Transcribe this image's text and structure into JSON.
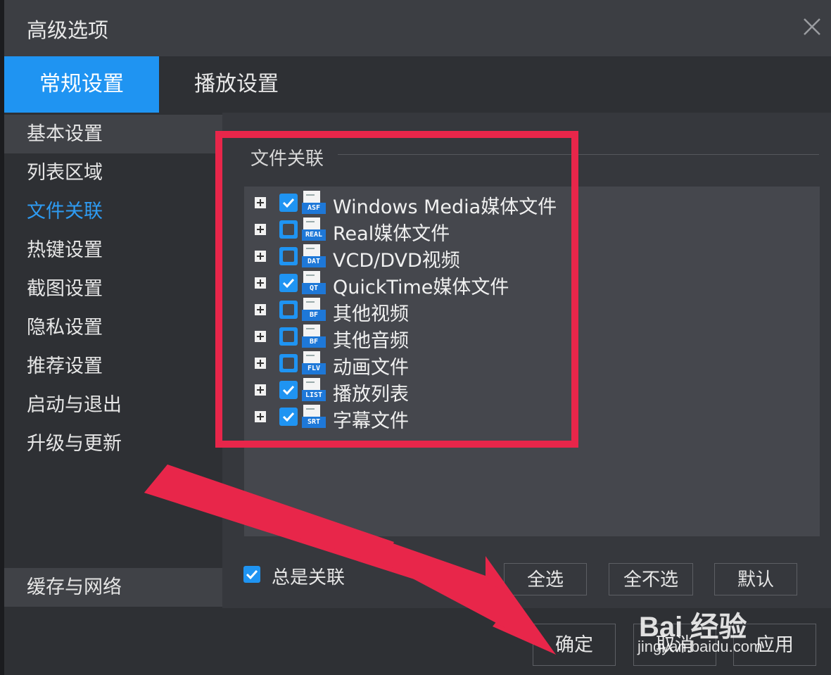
{
  "window": {
    "title": "高级选项"
  },
  "tabs": [
    {
      "label": "常规设置",
      "active": true
    },
    {
      "label": "播放设置",
      "active": false
    }
  ],
  "sidebar": {
    "items": [
      {
        "label": "基本设置"
      },
      {
        "label": "列表区域"
      },
      {
        "label": "文件关联"
      },
      {
        "label": "热键设置"
      },
      {
        "label": "截图设置"
      },
      {
        "label": "隐私设置"
      },
      {
        "label": "推荐设置"
      },
      {
        "label": "启动与退出"
      },
      {
        "label": "升级与更新"
      }
    ],
    "bottom_item": "缓存与网络"
  },
  "file_assoc": {
    "group_title": "文件关联",
    "rows": [
      {
        "label": "Windows Media媒体文件",
        "checked": true,
        "icon_tag": "ASF",
        "icon": "asf-file-icon"
      },
      {
        "label": "Real媒体文件",
        "checked": false,
        "icon_tag": "REAL",
        "icon": "real-file-icon"
      },
      {
        "label": "VCD/DVD视频",
        "checked": false,
        "icon_tag": "DAT",
        "icon": "dat-file-icon"
      },
      {
        "label": "QuickTime媒体文件",
        "checked": true,
        "icon_tag": "QT",
        "icon": "qt-file-icon"
      },
      {
        "label": "其他视频",
        "checked": false,
        "icon_tag": "BF",
        "icon": "bf-file-icon"
      },
      {
        "label": "其他音频",
        "checked": false,
        "icon_tag": "BF",
        "icon": "bf-file-icon"
      },
      {
        "label": "动画文件",
        "checked": false,
        "icon_tag": "FLV",
        "icon": "flv-file-icon"
      },
      {
        "label": "播放列表",
        "checked": true,
        "icon_tag": "LIST",
        "icon": "list-file-icon"
      },
      {
        "label": "字幕文件",
        "checked": true,
        "icon_tag": "SRT",
        "icon": "srt-file-icon"
      }
    ],
    "always_assoc_label": "总是关联",
    "always_assoc_checked": true,
    "select_all": "全选",
    "select_none": "全不选",
    "default": "默认"
  },
  "footer": {
    "ok": "确定",
    "cancel": "取消",
    "apply": "应用"
  },
  "watermark": {
    "logo": "Bai 经验",
    "url": "jingyan.baidu.com"
  },
  "colors": {
    "accent": "#1f94f2",
    "annotation": "#e8264a"
  }
}
